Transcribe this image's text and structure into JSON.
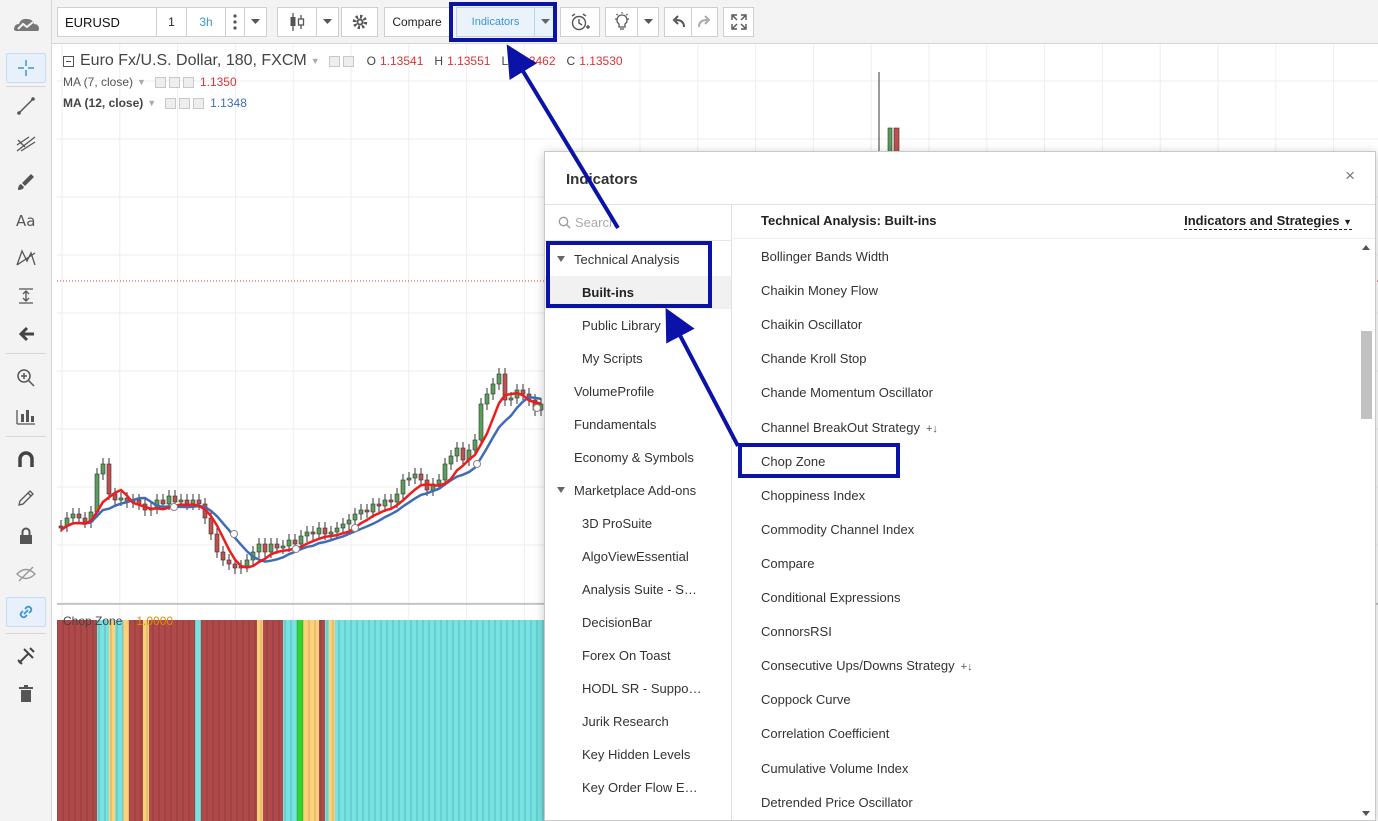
{
  "toolbar": {
    "symbol": "EURUSD",
    "interval_1": "1",
    "interval_3h": "3h",
    "compare_label": "Compare",
    "indicators_label": "Indicators"
  },
  "chart": {
    "title": "Euro Fx/U.S. Dollar, 180, FXCM",
    "ohlc": {
      "o_label": "O",
      "o": "1.13541",
      "h_label": "H",
      "h": "1.13551",
      "l_label": "L",
      "l": "1.13462",
      "c_label": "C",
      "c": "1.13530"
    },
    "ma7": {
      "label": "MA (7, close)",
      "value": "1.1350"
    },
    "ma12": {
      "label": "MA (12, close)",
      "value": "1.1348"
    },
    "chopzone": {
      "label": "Chop Zone",
      "value": "1.0000"
    },
    "colors": {
      "bull": "#5a9e5a",
      "bear": "#c0504d",
      "ma7": "#ee1c1c",
      "ma12": "#3e6db5",
      "chop_red": "#b04a4a",
      "chop_cyan": "#76e2e2",
      "chop_yellow": "#fdd17a",
      "chop_green": "#2ed62e",
      "annotation": "#0b12a8"
    }
  },
  "dialog": {
    "title": "Indicators",
    "close": "×",
    "search_placeholder": "Search",
    "categories": [
      {
        "label": "Technical Analysis",
        "level": 1,
        "expanded": true
      },
      {
        "label": "Built-ins",
        "level": 2,
        "selected": true
      },
      {
        "label": "Public Library",
        "level": 2
      },
      {
        "label": "My Scripts",
        "level": 2
      },
      {
        "label": "VolumeProfile",
        "level": 1
      },
      {
        "label": "Fundamentals",
        "level": 1
      },
      {
        "label": "Economy & Symbols",
        "level": 1
      },
      {
        "label": "Marketplace Add-ons",
        "level": 1,
        "expanded": true
      },
      {
        "label": "3D ProSuite",
        "level": 2
      },
      {
        "label": "AlgoViewEssential",
        "level": 2
      },
      {
        "label": "Analysis Suite - S…",
        "level": 2
      },
      {
        "label": "DecisionBar",
        "level": 2
      },
      {
        "label": "Forex On Toast",
        "level": 2
      },
      {
        "label": "HODL SR - Suppo…",
        "level": 2
      },
      {
        "label": "Jurik Research",
        "level": 2
      },
      {
        "label": "Key Hidden Levels",
        "level": 2
      },
      {
        "label": "Key Order Flow E…",
        "level": 2
      }
    ],
    "section_title": "Technical Analysis: Built-ins",
    "filter_label": "Indicators and Strategies",
    "strategy_mark": "+↓",
    "indicators": [
      {
        "label": "Bollinger Bands Width"
      },
      {
        "label": "Chaikin Money Flow"
      },
      {
        "label": "Chaikin Oscillator"
      },
      {
        "label": "Chande Kroll Stop"
      },
      {
        "label": "Chande Momentum Oscillator"
      },
      {
        "label": "Channel BreakOut Strategy",
        "strategy": true
      },
      {
        "label": "Chop Zone"
      },
      {
        "label": "Choppiness Index"
      },
      {
        "label": "Commodity Channel Index"
      },
      {
        "label": "Compare"
      },
      {
        "label": "Conditional Expressions"
      },
      {
        "label": "ConnorsRSI"
      },
      {
        "label": "Consecutive Ups/Downs Strategy",
        "strategy": true
      },
      {
        "label": "Coppock Curve"
      },
      {
        "label": "Correlation Coefficient"
      },
      {
        "label": "Cumulative Volume Index"
      },
      {
        "label": "Detrended Price Oscillator"
      }
    ]
  },
  "left_tools": [
    "cloud-logo-icon",
    "crosshair-icon",
    "trend-line-icon",
    "fib-icon",
    "brush-icon",
    "text-icon",
    "pattern-icon",
    "measure-icon",
    "arrow-left-icon",
    "zoom-icon",
    "bar-chart-icon",
    "magnet-icon",
    "pencil-icon",
    "lock-icon",
    "eye-hidden-icon",
    "link-icon",
    "tools-icon",
    "trash-icon"
  ]
}
